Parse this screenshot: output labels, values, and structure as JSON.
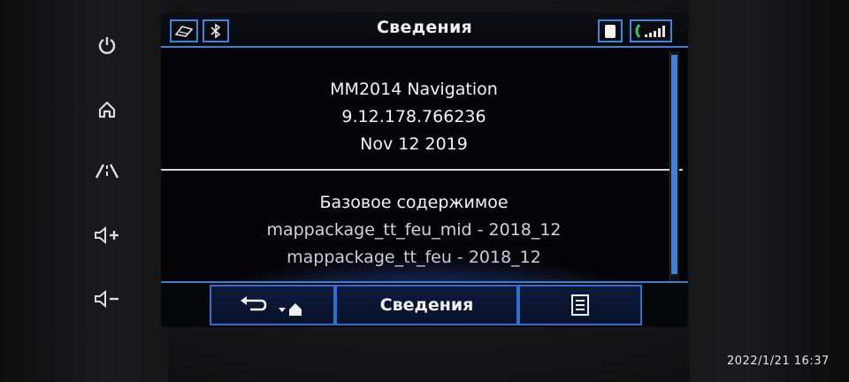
{
  "hardware_buttons": [
    {
      "name": "power-icon",
      "glyph": "⏻"
    },
    {
      "name": "home-icon",
      "glyph": "⌂"
    },
    {
      "name": "navigation-road-icon",
      "glyph": "/⁞\\"
    },
    {
      "name": "volume-up-icon",
      "glyph": "◁+"
    },
    {
      "name": "volume-down-icon",
      "glyph": "◁−"
    }
  ],
  "header": {
    "title": "Сведения",
    "left_icons": [
      "map-book-icon",
      "bluetooth-icon"
    ],
    "right_icons": [
      "phone-battery-icon",
      "phone-signal-icon"
    ]
  },
  "info": {
    "app_name": "MM2014 Navigation",
    "version": "9.12.178.766236",
    "date": "Nov 12 2019",
    "section_title": "Базовое содержимое",
    "packages": [
      "mappackage_tt_feu_mid - 2018_12",
      "mappackage_tt_feu - 2018_12"
    ]
  },
  "footer": {
    "back_glyph": "↩",
    "home_glyph": "▾⌂",
    "center_label": "Сведения",
    "menu_glyph": "☰"
  },
  "timestamp": "2022/1/21  16:37",
  "colors": {
    "accent": "#3c7fd6",
    "screen_bg": "#050507"
  }
}
